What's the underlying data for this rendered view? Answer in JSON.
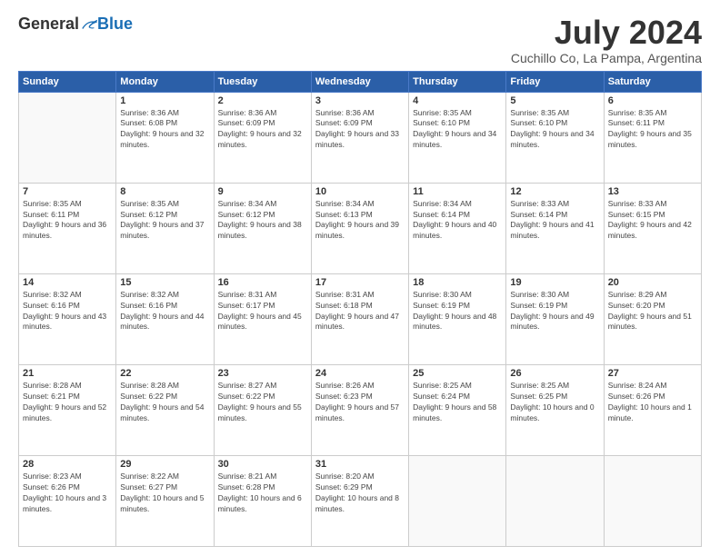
{
  "logo": {
    "general": "General",
    "blue": "Blue"
  },
  "title": "July 2024",
  "location": "Cuchillo Co, La Pampa, Argentina",
  "days_of_week": [
    "Sunday",
    "Monday",
    "Tuesday",
    "Wednesday",
    "Thursday",
    "Friday",
    "Saturday"
  ],
  "weeks": [
    [
      {
        "day": "",
        "sunrise": "",
        "sunset": "",
        "daylight": ""
      },
      {
        "day": "1",
        "sunrise": "Sunrise: 8:36 AM",
        "sunset": "Sunset: 6:08 PM",
        "daylight": "Daylight: 9 hours and 32 minutes."
      },
      {
        "day": "2",
        "sunrise": "Sunrise: 8:36 AM",
        "sunset": "Sunset: 6:09 PM",
        "daylight": "Daylight: 9 hours and 32 minutes."
      },
      {
        "day": "3",
        "sunrise": "Sunrise: 8:36 AM",
        "sunset": "Sunset: 6:09 PM",
        "daylight": "Daylight: 9 hours and 33 minutes."
      },
      {
        "day": "4",
        "sunrise": "Sunrise: 8:35 AM",
        "sunset": "Sunset: 6:10 PM",
        "daylight": "Daylight: 9 hours and 34 minutes."
      },
      {
        "day": "5",
        "sunrise": "Sunrise: 8:35 AM",
        "sunset": "Sunset: 6:10 PM",
        "daylight": "Daylight: 9 hours and 34 minutes."
      },
      {
        "day": "6",
        "sunrise": "Sunrise: 8:35 AM",
        "sunset": "Sunset: 6:11 PM",
        "daylight": "Daylight: 9 hours and 35 minutes."
      }
    ],
    [
      {
        "day": "7",
        "sunrise": "Sunrise: 8:35 AM",
        "sunset": "Sunset: 6:11 PM",
        "daylight": "Daylight: 9 hours and 36 minutes."
      },
      {
        "day": "8",
        "sunrise": "Sunrise: 8:35 AM",
        "sunset": "Sunset: 6:12 PM",
        "daylight": "Daylight: 9 hours and 37 minutes."
      },
      {
        "day": "9",
        "sunrise": "Sunrise: 8:34 AM",
        "sunset": "Sunset: 6:12 PM",
        "daylight": "Daylight: 9 hours and 38 minutes."
      },
      {
        "day": "10",
        "sunrise": "Sunrise: 8:34 AM",
        "sunset": "Sunset: 6:13 PM",
        "daylight": "Daylight: 9 hours and 39 minutes."
      },
      {
        "day": "11",
        "sunrise": "Sunrise: 8:34 AM",
        "sunset": "Sunset: 6:14 PM",
        "daylight": "Daylight: 9 hours and 40 minutes."
      },
      {
        "day": "12",
        "sunrise": "Sunrise: 8:33 AM",
        "sunset": "Sunset: 6:14 PM",
        "daylight": "Daylight: 9 hours and 41 minutes."
      },
      {
        "day": "13",
        "sunrise": "Sunrise: 8:33 AM",
        "sunset": "Sunset: 6:15 PM",
        "daylight": "Daylight: 9 hours and 42 minutes."
      }
    ],
    [
      {
        "day": "14",
        "sunrise": "Sunrise: 8:32 AM",
        "sunset": "Sunset: 6:16 PM",
        "daylight": "Daylight: 9 hours and 43 minutes."
      },
      {
        "day": "15",
        "sunrise": "Sunrise: 8:32 AM",
        "sunset": "Sunset: 6:16 PM",
        "daylight": "Daylight: 9 hours and 44 minutes."
      },
      {
        "day": "16",
        "sunrise": "Sunrise: 8:31 AM",
        "sunset": "Sunset: 6:17 PM",
        "daylight": "Daylight: 9 hours and 45 minutes."
      },
      {
        "day": "17",
        "sunrise": "Sunrise: 8:31 AM",
        "sunset": "Sunset: 6:18 PM",
        "daylight": "Daylight: 9 hours and 47 minutes."
      },
      {
        "day": "18",
        "sunrise": "Sunrise: 8:30 AM",
        "sunset": "Sunset: 6:19 PM",
        "daylight": "Daylight: 9 hours and 48 minutes."
      },
      {
        "day": "19",
        "sunrise": "Sunrise: 8:30 AM",
        "sunset": "Sunset: 6:19 PM",
        "daylight": "Daylight: 9 hours and 49 minutes."
      },
      {
        "day": "20",
        "sunrise": "Sunrise: 8:29 AM",
        "sunset": "Sunset: 6:20 PM",
        "daylight": "Daylight: 9 hours and 51 minutes."
      }
    ],
    [
      {
        "day": "21",
        "sunrise": "Sunrise: 8:28 AM",
        "sunset": "Sunset: 6:21 PM",
        "daylight": "Daylight: 9 hours and 52 minutes."
      },
      {
        "day": "22",
        "sunrise": "Sunrise: 8:28 AM",
        "sunset": "Sunset: 6:22 PM",
        "daylight": "Daylight: 9 hours and 54 minutes."
      },
      {
        "day": "23",
        "sunrise": "Sunrise: 8:27 AM",
        "sunset": "Sunset: 6:22 PM",
        "daylight": "Daylight: 9 hours and 55 minutes."
      },
      {
        "day": "24",
        "sunrise": "Sunrise: 8:26 AM",
        "sunset": "Sunset: 6:23 PM",
        "daylight": "Daylight: 9 hours and 57 minutes."
      },
      {
        "day": "25",
        "sunrise": "Sunrise: 8:25 AM",
        "sunset": "Sunset: 6:24 PM",
        "daylight": "Daylight: 9 hours and 58 minutes."
      },
      {
        "day": "26",
        "sunrise": "Sunrise: 8:25 AM",
        "sunset": "Sunset: 6:25 PM",
        "daylight": "Daylight: 10 hours and 0 minutes."
      },
      {
        "day": "27",
        "sunrise": "Sunrise: 8:24 AM",
        "sunset": "Sunset: 6:26 PM",
        "daylight": "Daylight: 10 hours and 1 minute."
      }
    ],
    [
      {
        "day": "28",
        "sunrise": "Sunrise: 8:23 AM",
        "sunset": "Sunset: 6:26 PM",
        "daylight": "Daylight: 10 hours and 3 minutes."
      },
      {
        "day": "29",
        "sunrise": "Sunrise: 8:22 AM",
        "sunset": "Sunset: 6:27 PM",
        "daylight": "Daylight: 10 hours and 5 minutes."
      },
      {
        "day": "30",
        "sunrise": "Sunrise: 8:21 AM",
        "sunset": "Sunset: 6:28 PM",
        "daylight": "Daylight: 10 hours and 6 minutes."
      },
      {
        "day": "31",
        "sunrise": "Sunrise: 8:20 AM",
        "sunset": "Sunset: 6:29 PM",
        "daylight": "Daylight: 10 hours and 8 minutes."
      },
      {
        "day": "",
        "sunrise": "",
        "sunset": "",
        "daylight": ""
      },
      {
        "day": "",
        "sunrise": "",
        "sunset": "",
        "daylight": ""
      },
      {
        "day": "",
        "sunrise": "",
        "sunset": "",
        "daylight": ""
      }
    ]
  ]
}
